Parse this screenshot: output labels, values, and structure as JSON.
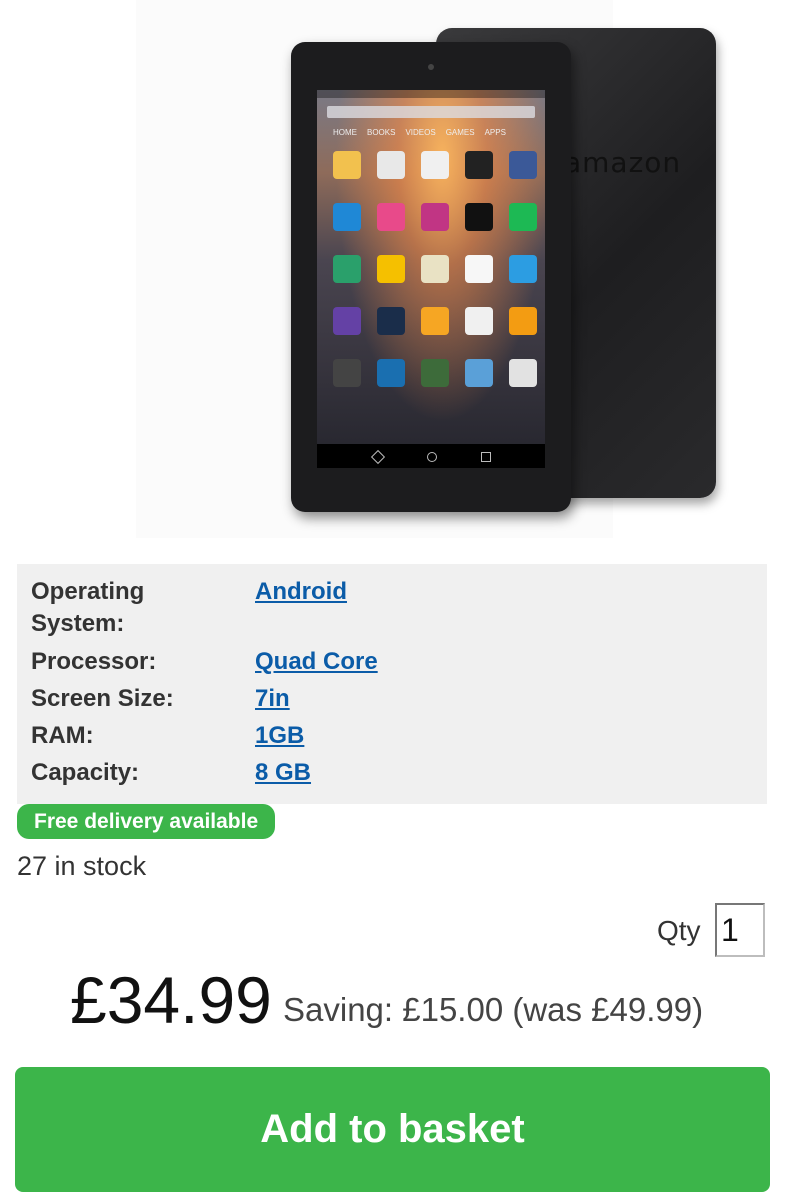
{
  "product_image": {
    "alt": "Amazon Fire 7 tablet",
    "brand_mark": "amazon",
    "screen_tabs": [
      "HOME",
      "BOOKS",
      "VIDEOS",
      "GAMES",
      "APPS"
    ]
  },
  "specs": [
    {
      "label": "Operating System:",
      "value": "Android"
    },
    {
      "label": "Processor:",
      "value": "Quad Core"
    },
    {
      "label": "Screen Size:",
      "value": "7in"
    },
    {
      "label": "RAM:",
      "value": "1GB"
    },
    {
      "label": "Capacity:",
      "value": "8 GB"
    }
  ],
  "delivery": {
    "badge": "Free delivery available"
  },
  "stock": {
    "text": "27 in stock"
  },
  "qty": {
    "label": "Qty",
    "value": "1"
  },
  "price": {
    "current": "£34.99",
    "saving_text": "Saving: £15.00 (was £49.99)"
  },
  "basket": {
    "label": "Add to basket"
  },
  "colors": {
    "accent_green": "#3cb54a",
    "link_blue": "#0b5ca8",
    "spec_background": "#f0f0f0"
  }
}
